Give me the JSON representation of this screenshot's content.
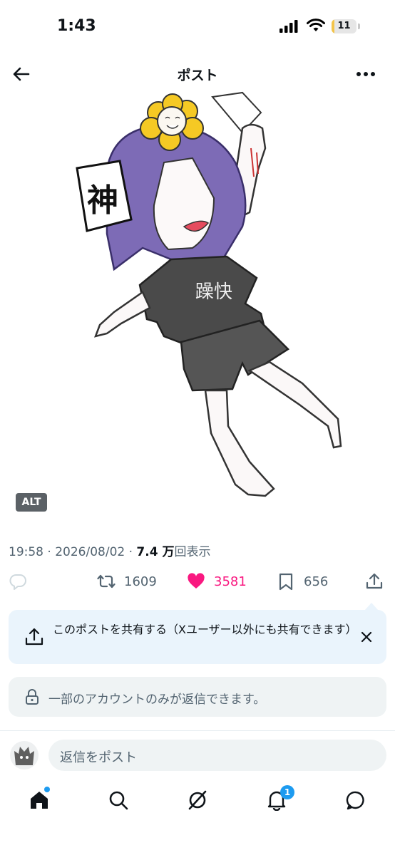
{
  "status_bar": {
    "time": "1:43",
    "battery_level": "11",
    "battery_color": "#f3c44a"
  },
  "header": {
    "title": "ポスト",
    "back_icon": "arrow-left-icon",
    "more_icon": "more-horizontal-icon"
  },
  "post": {
    "image_text": {
      "sign": "神",
      "shirt": "躁快"
    },
    "alt_label": "ALT",
    "time": "19:58",
    "date": "2026/08/02",
    "views_value": "7.4 万",
    "views_label": "回表示",
    "actions": {
      "reply_icon": "reply-icon",
      "retweet_count": "1609",
      "like_count": "3581",
      "bookmark_count": "656",
      "like_color": "#f91880"
    }
  },
  "share_callout": {
    "text": "このポストを共有する（Xユーザー以外にも共有できます）"
  },
  "restricted_replies": {
    "text": "一部のアカウントのみが返信できます。"
  },
  "reply_bar": {
    "placeholder": "返信をポスト"
  },
  "tabbar": {
    "tabs": [
      "home-icon",
      "search-icon",
      "grok-icon",
      "notifications-icon",
      "messages-icon"
    ],
    "notification_count": "1",
    "accent_color": "#1d9bf0"
  }
}
